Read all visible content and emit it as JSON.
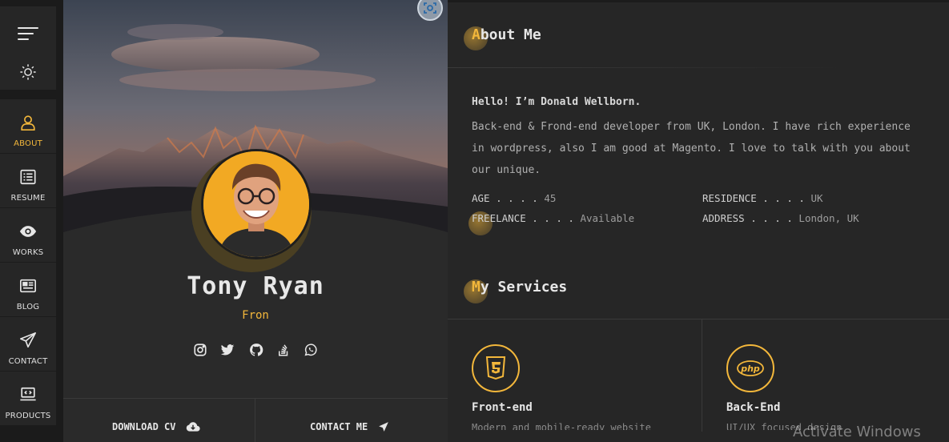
{
  "nav": {
    "items": [
      {
        "label": "ABOUT",
        "icon": "user-icon",
        "active": true
      },
      {
        "label": "RESUME",
        "icon": "resume-list-icon"
      },
      {
        "label": "WORKS",
        "icon": "eye-icon"
      },
      {
        "label": "BLOG",
        "icon": "newspaper-icon"
      },
      {
        "label": "CONTACT",
        "icon": "paper-plane-icon"
      },
      {
        "label": "PRODUCTS",
        "icon": "laptop-code-icon"
      }
    ]
  },
  "profile": {
    "name": "Tony Ryan",
    "role": "Fron",
    "socials": [
      "instagram-icon",
      "twitter-icon",
      "github-icon",
      "stack-overflow-icon",
      "whatsapp-icon"
    ],
    "download_label": "DOWNLOAD CV",
    "contact_label": "CONTACT ME"
  },
  "about": {
    "heading_first": "A",
    "heading_rest": "bout Me",
    "hello": "Hello! I’m Donald Wellborn.",
    "bio": "Back-end & Frond-end developer from UK, London. I have rich experience in wordpress, also I am good at Magento. I love to talk with you about our unique.",
    "facts": [
      {
        "key": "AGE . . . .",
        "value": "45"
      },
      {
        "key": "RESIDENCE . . . .",
        "value": "UK"
      },
      {
        "key": "FREELANCE . . . .",
        "value": "Available"
      },
      {
        "key": "ADDRESS . . . .",
        "value": "London, UK"
      }
    ]
  },
  "services": {
    "heading_first": "M",
    "heading_rest": "y Services",
    "items": [
      {
        "title": "Front-end",
        "icon": "html5-icon",
        "desc": "Modern and mobile-ready website"
      },
      {
        "title": "Back-End",
        "icon": "php-icon",
        "desc": "UI/UX focused design"
      }
    ]
  },
  "watermark": "Activate Windows",
  "colors": {
    "accent": "#f3b73b",
    "background": "#262626",
    "card": "#2a2a2a"
  }
}
